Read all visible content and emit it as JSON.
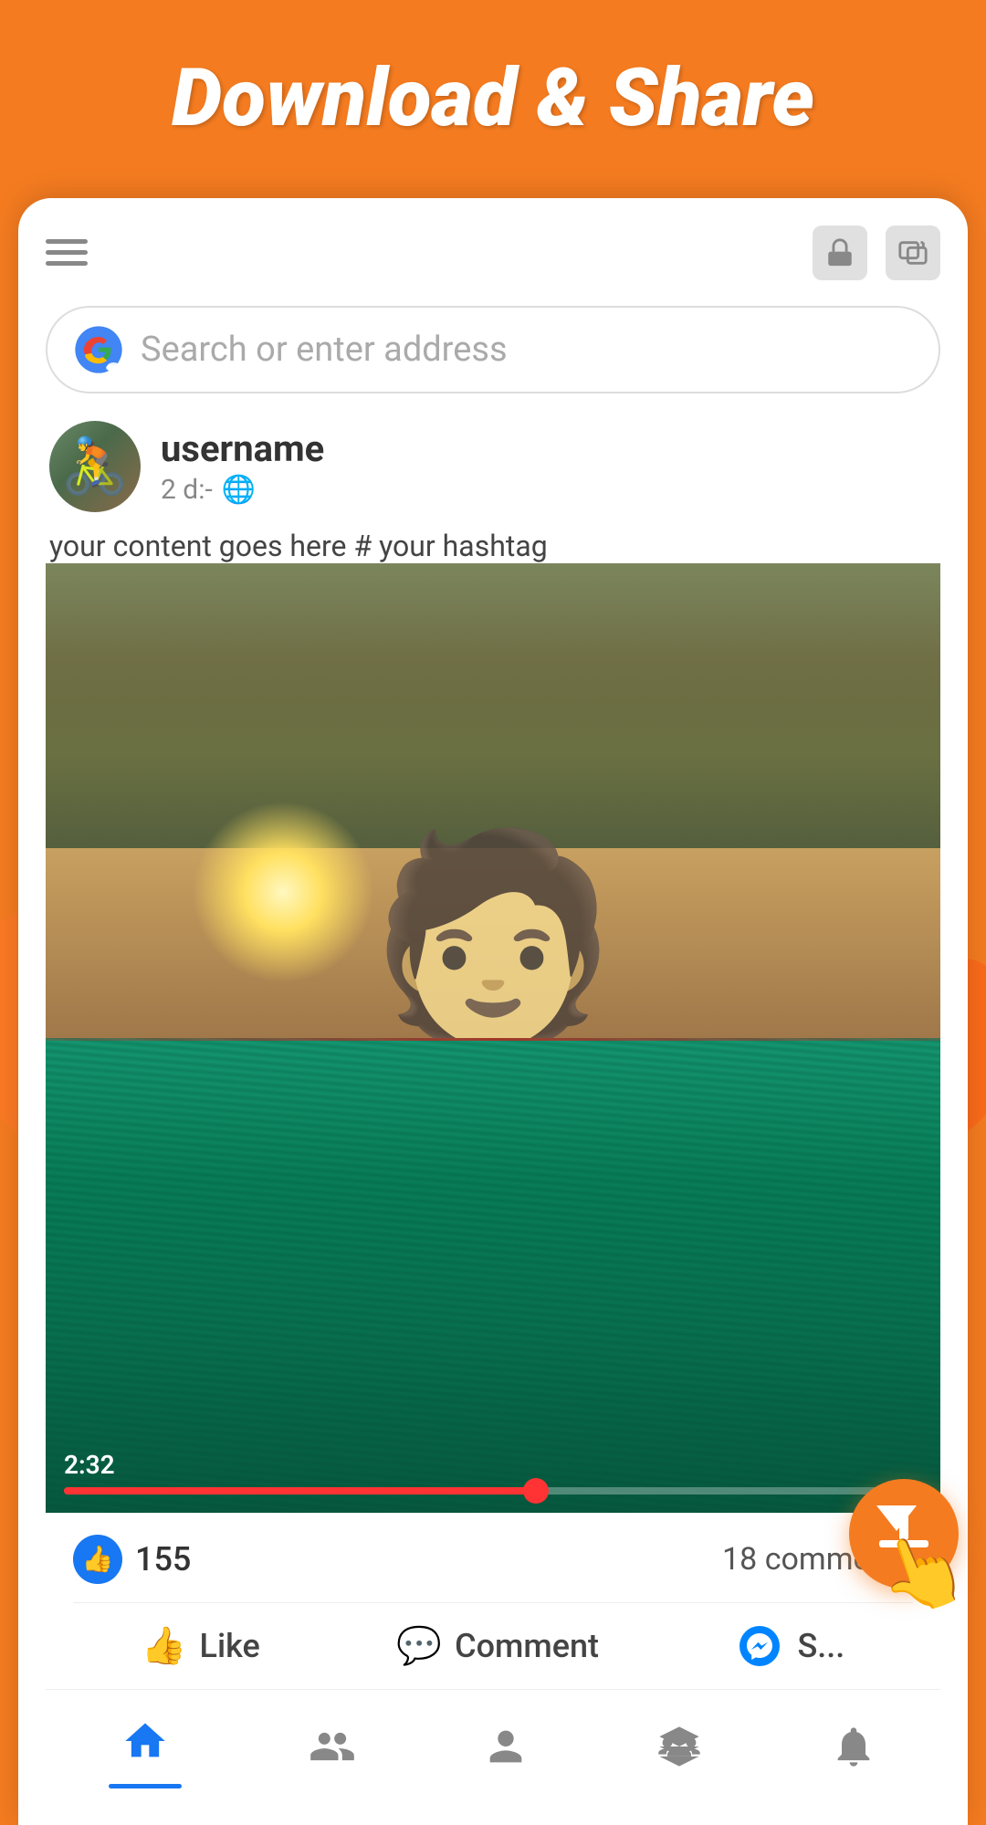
{
  "page": {
    "title": "Download & Share"
  },
  "browser": {
    "search_placeholder": "Search or enter address"
  },
  "post": {
    "username": "username",
    "time_ago": "2 d:-",
    "content": "your content goes here # your hashtag",
    "likes_count": "155",
    "comments_count": "18 comments",
    "video_time": "2:32"
  },
  "actions": {
    "like": "Like",
    "comment": "Comment",
    "share": "S..."
  },
  "nav": {
    "home": "home",
    "friends": "friends",
    "profile": "profile",
    "groups": "groups",
    "notifications": "notifications"
  }
}
